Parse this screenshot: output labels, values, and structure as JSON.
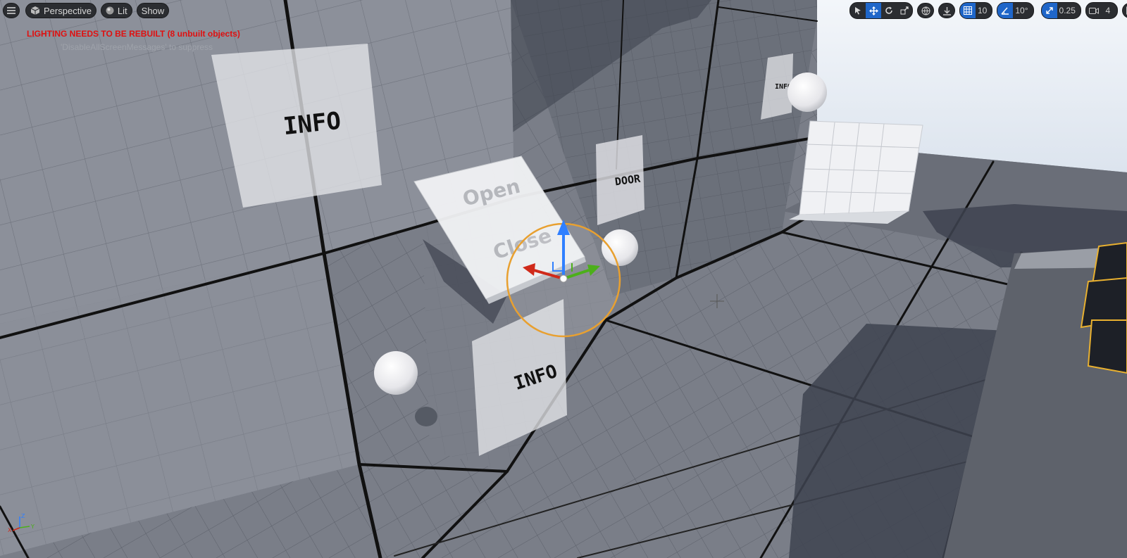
{
  "toolbar": {
    "menu_icon": "hamburger-icon",
    "view_mode": "Perspective",
    "lighting_mode": "Lit",
    "show_label": "Show",
    "grid_snap_value": "10",
    "rotation_snap_value": "10°",
    "scale_snap_value": "0.25",
    "camera_speed_value": "4"
  },
  "messages": {
    "warning": "LIGHTING NEEDS TO BE REBUILT (8 unbuilt objects)",
    "suppress": "'DisableAllScreenMessages' to suppress"
  },
  "scene": {
    "sign_info_large": "INFO",
    "sign_door": "DOOR",
    "sign_info_small": "INFO",
    "sign_info_far": "INFO",
    "button_open": "Open",
    "button_close": "Close"
  },
  "axis_gizmo": {
    "z": "Z",
    "x": "X",
    "y": "Y"
  },
  "colors": {
    "warning": "#e01010",
    "active_tool": "#1f66c9",
    "gizmo_z": "#2f7fff",
    "gizmo_x": "#d02a1a",
    "gizmo_y": "#4caf1a",
    "selection": "#e8a030"
  }
}
